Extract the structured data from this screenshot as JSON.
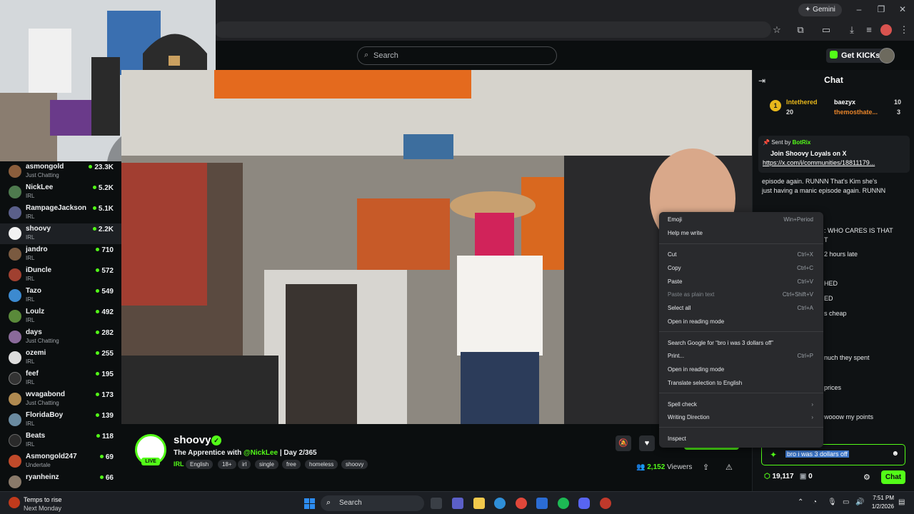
{
  "browser": {
    "gemini_label": "Gemini",
    "window_controls": [
      "–",
      "❐",
      "✕"
    ]
  },
  "header": {
    "search_placeholder": "Search",
    "get_kicks_label": "Get KICKs"
  },
  "sidebar": {
    "channels": [
      {
        "name": "asmongold",
        "category": "Just Chatting",
        "viewers": "23.3K",
        "color": "#8b5e3c"
      },
      {
        "name": "NickLee",
        "category": "IRL",
        "viewers": "5.2K",
        "color": "#4e7a4e"
      },
      {
        "name": "RampageJackson",
        "category": "IRL",
        "viewers": "5.1K",
        "color": "#5a5f8a"
      },
      {
        "name": "shoovy",
        "category": "IRL",
        "viewers": "2.2K",
        "color": "#f2f2f2",
        "active": true
      },
      {
        "name": "jandro",
        "category": "IRL",
        "viewers": "710",
        "color": "#7a5a40"
      },
      {
        "name": "iDuncle",
        "category": "IRL",
        "viewers": "572",
        "color": "#a04030"
      },
      {
        "name": "Tazo",
        "category": "IRL",
        "viewers": "549",
        "color": "#3c8ad0"
      },
      {
        "name": "Loulz",
        "category": "IRL",
        "viewers": "492",
        "color": "#5a8a3a"
      },
      {
        "name": "days",
        "category": "Just Chatting",
        "viewers": "282",
        "color": "#8a6a9a"
      },
      {
        "name": "ozemi",
        "category": "IRL",
        "viewers": "255",
        "color": "#dddddd"
      },
      {
        "name": "feef",
        "category": "IRL",
        "viewers": "195",
        "color": "#333333"
      },
      {
        "name": "wvagabond",
        "category": "Just Chatting",
        "viewers": "173",
        "color": "#b08a50"
      },
      {
        "name": "FloridaBoy",
        "category": "IRL",
        "viewers": "139",
        "color": "#6a8aa0"
      },
      {
        "name": "Beats",
        "category": "IRL",
        "viewers": "118",
        "color": "#2a2a2a"
      },
      {
        "name": "Asmongold247",
        "category": "Undertale",
        "viewers": "69",
        "color": "#c04a2a"
      },
      {
        "name": "ryanheinz",
        "category": "",
        "viewers": "66",
        "color": "#8a7a6a"
      }
    ]
  },
  "stream": {
    "streamer": "shoovy",
    "live_label": "LIVE",
    "title_prefix": "The Apprentice with ",
    "title_mention": "@NickLee",
    "title_suffix": " | Day 2/365",
    "category": "IRL",
    "tags": [
      "English",
      "18+",
      "irl",
      "single",
      "free",
      "homeless",
      "shoovy"
    ],
    "viewer_count": "2,152",
    "viewers_label": "Viewers"
  },
  "chat": {
    "title": "Chat",
    "leaderboard": {
      "rank1_badge": "1",
      "rank1_name": "Intethered",
      "rank1_count": "20",
      "rank2_name": "baezyx",
      "rank2_count": "10",
      "rank3_name": "themosthate...",
      "rank3_count": "3"
    },
    "pinned": {
      "sent_by": "Sent by",
      "bot_name": "BotRix",
      "message": "Join Shoovy Loyals on X",
      "url": "https://x.com/i/communities/18811179..."
    },
    "lines": [
      "episode again. RUNNN      That's Kim she's",
      "just having a manic episode again. RUNNN",
      ": WHO CARES IS THAT",
      "T",
      "2 hours late",
      "HED",
      "ED",
      "s cheap",
      "nuch they spent",
      "prices",
      "wooow my points"
    ],
    "input_text": "bro i was 3 dollars off",
    "points": "19,117",
    "points_other": "0",
    "send_label": "Chat"
  },
  "context_menu": {
    "items": [
      {
        "label": "Emoji",
        "shortcut": "Win+Period"
      },
      {
        "label": "Help me write",
        "shortcut": ""
      },
      {
        "label": "Cut",
        "shortcut": "Ctrl+X"
      },
      {
        "label": "Copy",
        "shortcut": "Ctrl+C"
      },
      {
        "label": "Paste",
        "shortcut": "Ctrl+V"
      },
      {
        "label": "Paste as plain text",
        "shortcut": "Ctrl+Shift+V",
        "disabled": true
      },
      {
        "label": "Select all",
        "shortcut": "Ctrl+A"
      },
      {
        "label": "Open in reading mode",
        "shortcut": ""
      },
      {
        "label": "Search Google for “bro i was 3 dollars off”",
        "shortcut": ""
      },
      {
        "label": "Print...",
        "shortcut": "Ctrl+P"
      },
      {
        "label": "Open in reading mode",
        "shortcut": ""
      },
      {
        "label": "Translate selection to English",
        "shortcut": ""
      },
      {
        "label": "Spell check",
        "shortcut": "›"
      },
      {
        "label": "Writing Direction",
        "shortcut": "›"
      },
      {
        "label": "Inspect",
        "shortcut": ""
      }
    ]
  },
  "taskbar": {
    "weather_line1": "Temps to rise",
    "weather_line2": "Next Monday",
    "search_label": "Search",
    "time": "7:51 PM",
    "date": "1/2/2026"
  },
  "colors": {
    "accent": "#53fc18",
    "background": "#0b0e0f",
    "menu_bg": "#292a2d"
  }
}
